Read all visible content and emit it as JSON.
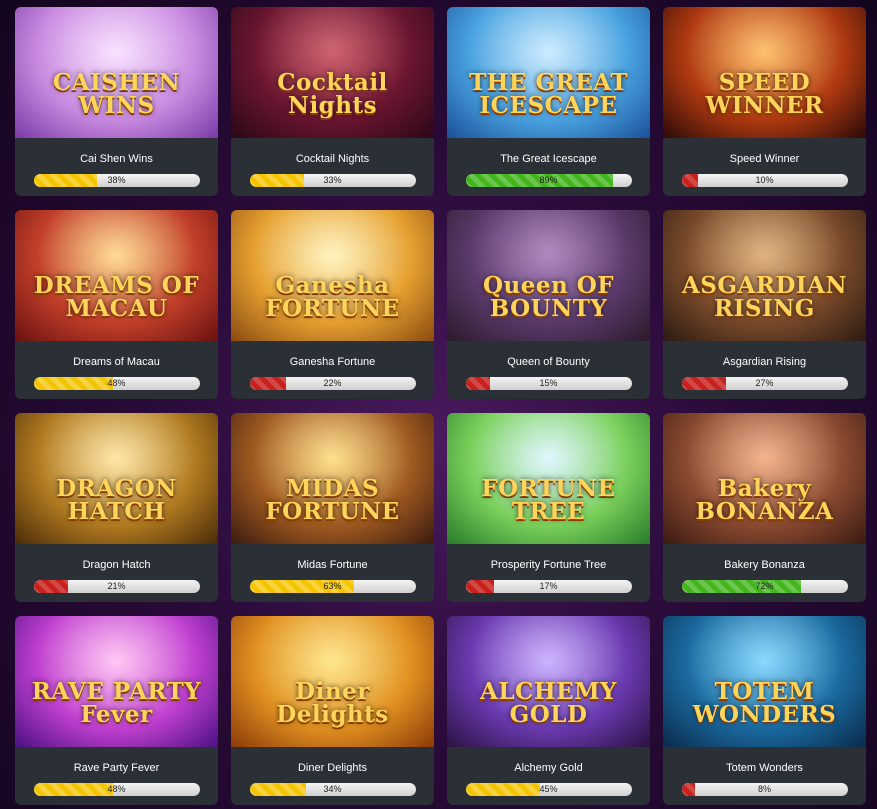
{
  "games": [
    {
      "name": "Cai Shen Wins",
      "art_title": "CAISHEN WINS",
      "rtp": 38,
      "rtp_label": "38%",
      "level": "yellow",
      "bg": [
        "#f6d9ff",
        "#c98ae0",
        "#7a3aa8"
      ]
    },
    {
      "name": "Cocktail Nights",
      "art_title": "Cocktail Nights",
      "rtp": 33,
      "rtp_label": "33%",
      "level": "yellow",
      "bg": [
        "#c23a4a",
        "#6a1530",
        "#2a0816"
      ]
    },
    {
      "name": "The Great Icescape",
      "art_title": "THE GREAT ICESCAPE",
      "rtp": 89,
      "rtp_label": "89%",
      "level": "green",
      "bg": [
        "#bfe6ff",
        "#4aa3e0",
        "#1a4f9a"
      ]
    },
    {
      "name": "Speed Winner",
      "art_title": "SPEED WINNER",
      "rtp": 10,
      "rtp_label": "10%",
      "level": "red",
      "bg": [
        "#ffb04a",
        "#b03a10",
        "#2a0a08"
      ]
    },
    {
      "name": "Dreams of Macau",
      "art_title": "DREAMS OF MACAU",
      "rtp": 48,
      "rtp_label": "48%",
      "level": "yellow",
      "bg": [
        "#ffd27a",
        "#c2402a",
        "#6a1010"
      ]
    },
    {
      "name": "Ganesha Fortune",
      "art_title": "Ganesha FORTUNE",
      "rtp": 22,
      "rtp_label": "22%",
      "level": "red",
      "bg": [
        "#fff0b0",
        "#e6a030",
        "#8a4a10"
      ]
    },
    {
      "name": "Queen of Bounty",
      "art_title": "Queen OF BOUNTY",
      "rtp": 15,
      "rtp_label": "15%",
      "level": "red",
      "bg": [
        "#9a6ab0",
        "#5a3a6a",
        "#2a1a2a"
      ]
    },
    {
      "name": "Asgardian Rising",
      "art_title": "ASGARDIAN RISING",
      "rtp": 27,
      "rtp_label": "27%",
      "level": "red",
      "bg": [
        "#d8a060",
        "#7a4a2a",
        "#2a1a12"
      ]
    },
    {
      "name": "Dragon Hatch",
      "art_title": "DRAGON HATCH",
      "rtp": 21,
      "rtp_label": "21%",
      "level": "red",
      "bg": [
        "#ffe090",
        "#b07a20",
        "#4a2a08"
      ]
    },
    {
      "name": "Midas Fortune",
      "art_title": "MIDAS FORTUNE",
      "rtp": 63,
      "rtp_label": "63%",
      "level": "yellow",
      "bg": [
        "#ffd870",
        "#a05a20",
        "#3a1a10"
      ]
    },
    {
      "name": "Prosperity Fortune Tree",
      "art_title": "FORTUNE TREE",
      "rtp": 17,
      "rtp_label": "17%",
      "level": "red",
      "bg": [
        "#d8f5ff",
        "#7ad05a",
        "#2a7a2a"
      ]
    },
    {
      "name": "Bakery Bonanza",
      "art_title": "Bakery BONANZA",
      "rtp": 72,
      "rtp_label": "72%",
      "level": "green",
      "bg": [
        "#f0a070",
        "#8a4a30",
        "#3a1a12"
      ]
    },
    {
      "name": "Rave Party Fever",
      "art_title": "RAVE PARTY Fever",
      "rtp": 48,
      "rtp_label": "48%",
      "level": "yellow",
      "bg": [
        "#ffb8f0",
        "#c040d0",
        "#4a1080"
      ]
    },
    {
      "name": "Diner Delights",
      "art_title": "Diner Delights",
      "rtp": 34,
      "rtp_label": "34%",
      "level": "yellow",
      "bg": [
        "#ffe070",
        "#e09020",
        "#8a3a08"
      ]
    },
    {
      "name": "Alchemy Gold",
      "art_title": "ALCHEMY GOLD",
      "rtp": 45,
      "rtp_label": "45%",
      "level": "yellow",
      "bg": [
        "#c0a0ff",
        "#6a3ab0",
        "#2a1240"
      ]
    },
    {
      "name": "Totem Wonders",
      "art_title": "TOTEM WONDERS",
      "rtp": 8,
      "rtp_label": "8%",
      "level": "red",
      "bg": [
        "#6ad0ff",
        "#1a6aa0",
        "#0a2a4a"
      ]
    }
  ]
}
